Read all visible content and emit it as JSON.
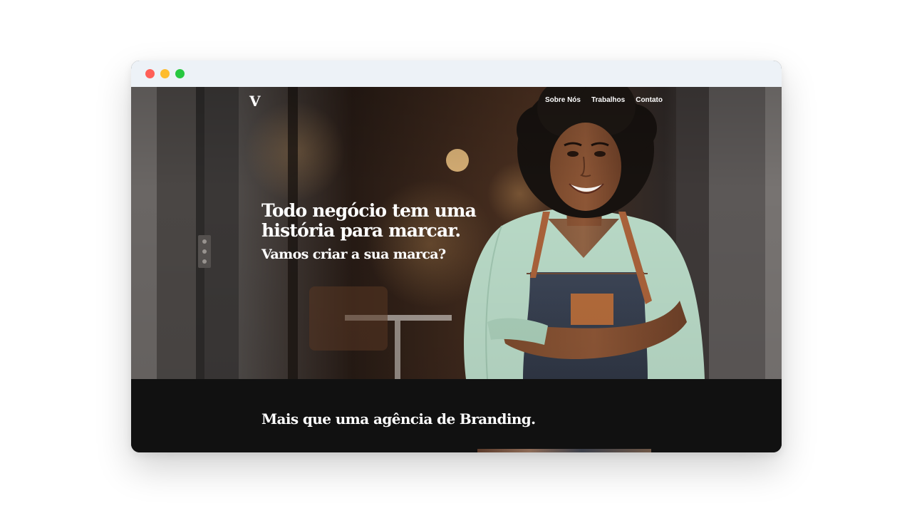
{
  "window": {
    "controls": {
      "close_color": "#ff5f57",
      "minimize_color": "#febc2e",
      "maximize_color": "#28c840"
    }
  },
  "header": {
    "logo": "V",
    "nav": [
      {
        "label": "Sobre Nós"
      },
      {
        "label": "Trabalhos"
      },
      {
        "label": "Contato"
      }
    ]
  },
  "hero": {
    "headline": "Todo negócio tem uma história para marcar.",
    "subheadline": "Vamos criar a sua marca?",
    "image_subject": "smiling woman in green blouse and denim apron standing in cafe doorway"
  },
  "section": {
    "title": "Mais que uma agência de Branding."
  },
  "colors": {
    "section_background": "#111111",
    "text": "#ffffff",
    "titlebar": "#edf2f7"
  }
}
